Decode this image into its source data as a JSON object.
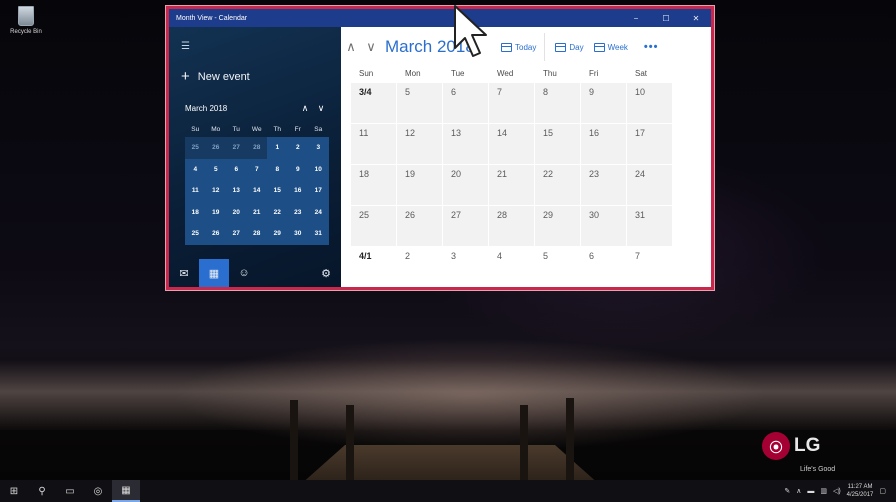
{
  "desktop": {
    "recycle_bin_label": "Recycle Bin",
    "brand_logo": "LG",
    "brand_tagline": "Life's Good"
  },
  "window": {
    "title": "Month View - Calendar",
    "minimize_glyph": "−",
    "maximize_glyph": "☐",
    "close_glyph": "✕",
    "border_color": "#c8284c",
    "titlebar_color": "#1e3c8c"
  },
  "sidebar": {
    "menu_icon": "☰",
    "new_event_label": "New event",
    "mini_calendar": {
      "month_label": "March 2018",
      "up_arrow": "∧",
      "down_arrow": "∨",
      "weekday_headers": [
        "Su",
        "Mo",
        "Tu",
        "We",
        "Th",
        "Fr",
        "Sa"
      ],
      "weeks": [
        [
          "25",
          "26",
          "27",
          "28",
          "1",
          "2",
          "3"
        ],
        [
          "4",
          "5",
          "6",
          "7",
          "8",
          "9",
          "10"
        ],
        [
          "11",
          "12",
          "13",
          "14",
          "15",
          "16",
          "17"
        ],
        [
          "18",
          "19",
          "20",
          "21",
          "22",
          "23",
          "24"
        ],
        [
          "25",
          "26",
          "27",
          "28",
          "29",
          "30",
          "31"
        ]
      ],
      "dim_first_week_count": 4
    },
    "bottom_icons": [
      "mail-icon",
      "calendar-icon",
      "people-icon",
      "settings-icon"
    ]
  },
  "toolbar": {
    "prev_arrow": "∧",
    "next_arrow": "∨",
    "month_title": "March 2018",
    "today_label": "Today",
    "day_label": "Day",
    "week_label": "Week",
    "more_label": "•••",
    "accent_color": "#2a6fcf"
  },
  "month_grid": {
    "weekday_headers": [
      "Sun",
      "Mon",
      "Tue",
      "Wed",
      "Thu",
      "Fri",
      "Sat"
    ],
    "weeks": [
      [
        "3/4",
        "5",
        "6",
        "7",
        "8",
        "9",
        "10"
      ],
      [
        "11",
        "12",
        "13",
        "14",
        "15",
        "16",
        "17"
      ],
      [
        "18",
        "19",
        "20",
        "21",
        "22",
        "23",
        "24"
      ],
      [
        "25",
        "26",
        "27",
        "28",
        "29",
        "30",
        "31"
      ],
      [
        "4/1",
        "2",
        "3",
        "4",
        "5",
        "6",
        "7"
      ]
    ]
  },
  "taskbar": {
    "clock_time": "11:27 AM",
    "clock_date": "4/25/2017"
  }
}
